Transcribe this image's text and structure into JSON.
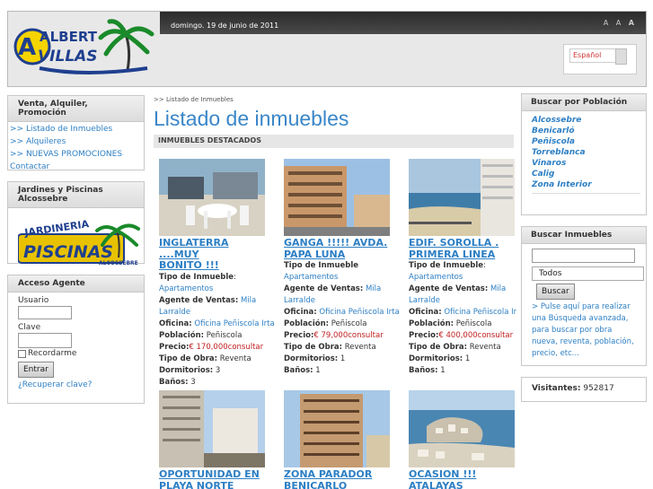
{
  "header": {
    "date": "domingo. 19 de junio de 2011",
    "font_controls": [
      "A",
      "A",
      "A"
    ],
    "language": "Español",
    "logo_text_top": "ALBERT",
    "logo_text_bottom": "VILLAS"
  },
  "left": {
    "menu_title": "Venta, Alquiler, Promoción",
    "menu_items": [
      ">> Listado de Inmuebles",
      ">> Alquileres",
      ">> NUEVAS PROMOCIONES",
      "Contactar"
    ],
    "garden_title": "Jardines y Piscinas Alcossebre",
    "garden_logo_top": "JARDINERIA",
    "garden_logo_bottom": "PISCINAS",
    "garden_logo_side": "ALCOSSEBRE",
    "login_title": "Acceso Agente",
    "user_label": "Usuario",
    "pass_label": "Clave",
    "remember_label": "Recordarme",
    "login_button": "Entrar",
    "recover_link": "¿Recuperar clave?"
  },
  "main": {
    "breadcrumb": ">> Listado de Inmuebles",
    "title": "Listado de inmuebles",
    "subtitle": "INMUEBLES DESTACADOS",
    "labels": {
      "type": "Tipo de Inmueble",
      "agent": "Agente de Ventas:",
      "office": "Oficina:",
      "town": "Población:",
      "price": "Precio:",
      "work": "Tipo de Obra:",
      "bedrooms": "Dormitorios:",
      "baths": "Baños:"
    },
    "listings": [
      {
        "title1": "INGLATERRA ....MUY",
        "title2": "BONITO !!!",
        "type": "Apartamentos",
        "agent": "Mila",
        "agent2": "Larralde",
        "office": "Oficina Peñiscola Irta",
        "town": "Peñiscola",
        "price": "€ 170,000consultar",
        "work": "Reventa",
        "bedrooms": "3",
        "baths": "3"
      },
      {
        "title1": "GANGA !!!!! AVDA.",
        "title2": "PAPA LUNA",
        "type": "Apartamentos",
        "agent": "Mila",
        "agent2": "Larralde",
        "office": "Oficina Peñiscola Irta",
        "town": "Peñiscola",
        "price": "€ 79,000consultar",
        "work": "Reventa",
        "bedrooms": "1",
        "baths": "1"
      },
      {
        "title1": "EDIF. SOROLLA .",
        "title2": "PRIMERA LINEA",
        "type": "Apartamentos",
        "agent": "Mila",
        "agent2": "Larralde",
        "office": "Oficina Peñiscola Ir",
        "town": "Peñiscola",
        "price": "€ 400,000consultar",
        "work": "Reventa",
        "bedrooms": "1",
        "baths": "1"
      },
      {
        "title1": "OPORTUNIDAD EN",
        "title2": "PLAYA NORTE"
      },
      {
        "title1": "ZONA PARADOR",
        "title2": "BENICARLO"
      },
      {
        "title1": "OCASION !!!",
        "title2": "ATALAYAS"
      }
    ]
  },
  "right": {
    "towns_title": "Buscar por Población",
    "towns": [
      "Alcossebre",
      "Benicarló",
      "Peñiscola",
      "Torreblanca",
      "Vinaros",
      "Calig",
      "Zona Interior"
    ],
    "search_title": "Buscar Inmuebles",
    "search_select": "Todos",
    "search_button": "Buscar",
    "advanced_text": "> Pulse aquí para realizar una Búsqueda avanzada, para buscar por obra nueva, reventa, población, precio, etc...",
    "visitors_label": "Visitantes:",
    "visitors_count": "952817"
  },
  "colors": {
    "accent": "#2d7fc4",
    "title": "#3a86c8",
    "price": "#c02020"
  }
}
